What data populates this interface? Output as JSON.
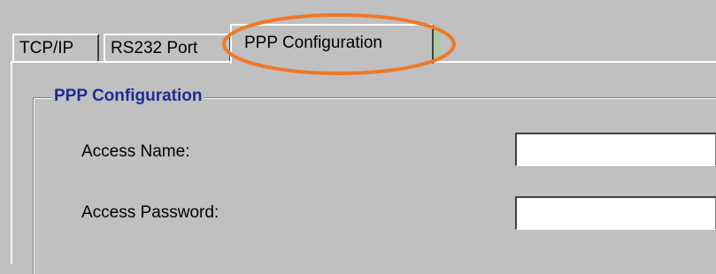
{
  "tabs": [
    {
      "label": "TCP/IP",
      "selected": false
    },
    {
      "label": "RS232 Port",
      "selected": false
    },
    {
      "label": "PPP Configuration",
      "selected": true
    }
  ],
  "annotation": {
    "shape": "ellipse",
    "color": "#f07828",
    "target": "PPP Configuration tab"
  },
  "group": {
    "title": "PPP Configuration",
    "title_color": "#1c2c96",
    "fields": [
      {
        "label": "Access Name:",
        "value": ""
      },
      {
        "label": "Access Password:",
        "value": ""
      }
    ]
  }
}
